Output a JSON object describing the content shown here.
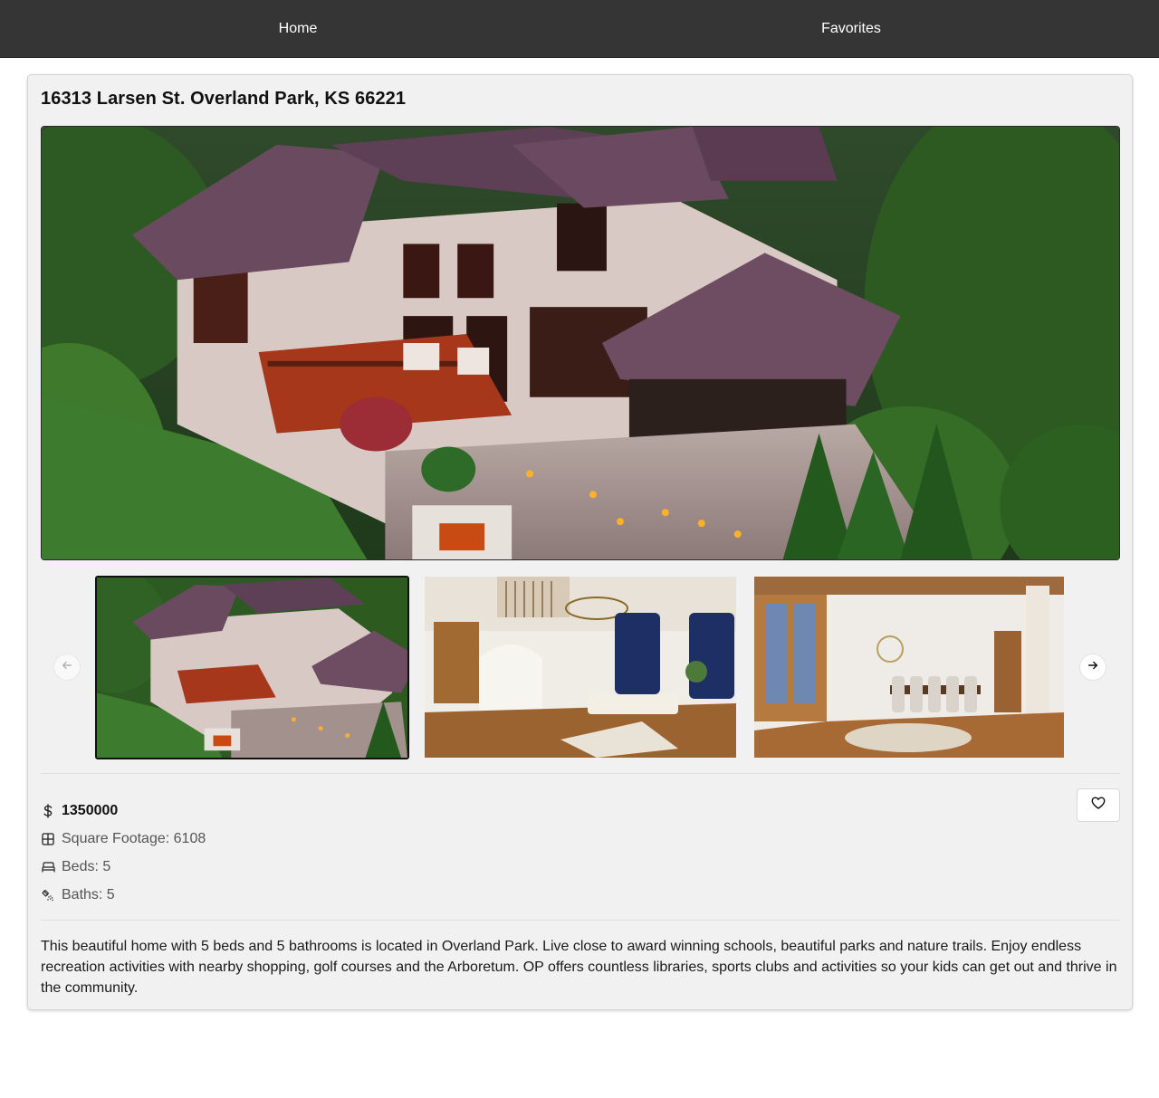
{
  "nav": {
    "home_label": "Home",
    "favorites_label": "Favorites"
  },
  "listing": {
    "address": "16313 Larsen St. Overland Park, KS 66221",
    "price": "1350000",
    "square_footage": "Square Footage: 6108",
    "beds": "Beds: 5",
    "baths": "Baths: 5",
    "description": "This beautiful home with 5 beds and 5 bathrooms is located in Overland Park. Live close to award winning schools, beautiful parks and nature trails. Enjoy endless recreation activities with nearby shopping, golf courses and the Arboretum. OP offers countless libraries, sports clubs and activities so your kids can get out and thrive in the community."
  },
  "gallery": {
    "selected_index": 0,
    "thumbnails": [
      "exterior-aerial-photo",
      "living-room-photo",
      "dining-room-photo"
    ]
  },
  "icons": {
    "price": "dollar-icon",
    "sqft": "grid-icon",
    "beds": "bed-icon",
    "baths": "shower-icon",
    "favorite": "heart-icon",
    "prev": "arrow-left-icon",
    "next": "arrow-right-icon"
  },
  "colors": {
    "navbar": "#353535",
    "card_background": "#f1f1f1",
    "text_primary": "#111111",
    "text_muted": "#555555"
  }
}
